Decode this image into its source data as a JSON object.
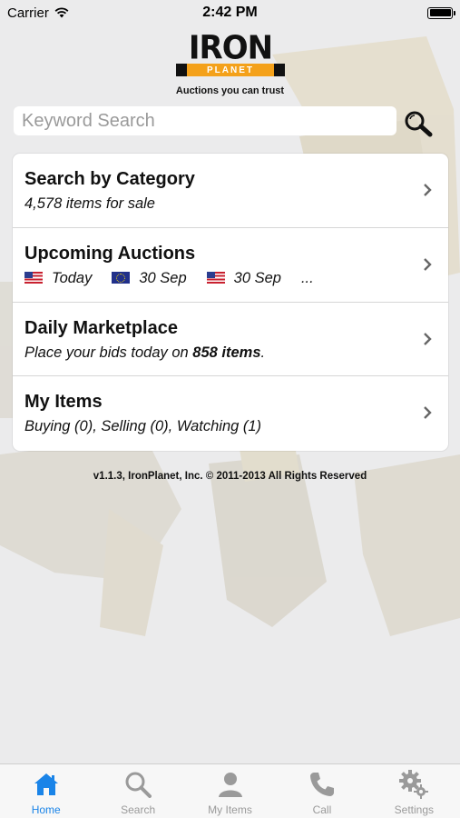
{
  "status_bar": {
    "carrier": "Carrier",
    "time": "2:42 PM"
  },
  "header": {
    "logo_top": "IRON",
    "logo_bottom": "PLANET",
    "tagline": "Auctions you can trust"
  },
  "search": {
    "placeholder": "Keyword Search",
    "value": ""
  },
  "menu": {
    "category": {
      "title": "Search by Category",
      "subtitle": "4,578 items for sale"
    },
    "auctions": {
      "title": "Upcoming Auctions",
      "dates": [
        {
          "flag": "us-flag",
          "label": "Today"
        },
        {
          "flag": "eu-flag",
          "label": "30 Sep"
        },
        {
          "flag": "us-flag",
          "label": "30 Sep"
        }
      ],
      "more": "..."
    },
    "marketplace": {
      "title": "Daily Marketplace",
      "subtitle_prefix": "Place your bids today on ",
      "subtitle_bold": "858 items",
      "subtitle_suffix": "."
    },
    "my_items": {
      "title": "My Items",
      "subtitle": "Buying (0), Selling (0), Watching (1)"
    }
  },
  "footer": {
    "copyright": "v1.1.3, IronPlanet, Inc. © 2011-2013 All Rights Reserved"
  },
  "tabbar": {
    "active_color": "#1a84e8",
    "inactive_color": "#9a9a9a",
    "items": [
      {
        "label": "Home",
        "icon": "home-icon",
        "active": true
      },
      {
        "label": "Search",
        "icon": "search-icon",
        "active": false
      },
      {
        "label": "My Items",
        "icon": "person-icon",
        "active": false
      },
      {
        "label": "Call",
        "icon": "phone-icon",
        "active": false
      },
      {
        "label": "Settings",
        "icon": "gear-icon",
        "active": false
      }
    ]
  },
  "colors": {
    "brand_orange": "#f4a11a",
    "background": "#e9e9ea"
  }
}
